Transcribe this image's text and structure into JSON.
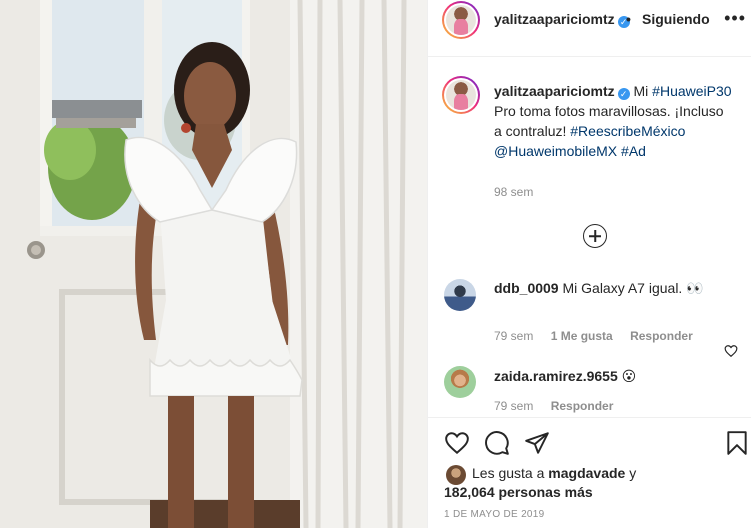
{
  "post": {
    "username": "yalitzaapariciomtz",
    "verified_icon": "verified-badge-icon",
    "follow_status": "Siguiendo",
    "separator": "•",
    "more_icon": "more-options-icon",
    "photo_description_icon": "photo"
  },
  "caption": {
    "username": "yalitzaapariciomtz",
    "text_1": "Mi",
    "hashtag_1": "#HuaweiP30",
    "text_2": "Pro toma fotos maravillosas. ¡Incluso a contraluz!",
    "hashtag_2": "#ReescribeMéxico",
    "mention": "@HuaweimobileMX",
    "hashtag_3": "#Ad",
    "time": "98 sem"
  },
  "load_more_icon": "plus-circle-icon",
  "comments": [
    {
      "username": "ddb_0009",
      "text": "Mi Galaxy A7 igual. 👀",
      "time": "79 sem",
      "likes": "1 Me gusta",
      "reply": "Responder"
    },
    {
      "username": "zaida.ramirez.9655",
      "text": "😮",
      "time": "79 sem",
      "reply": "Responder"
    }
  ],
  "actions": {
    "like_icon": "heart-icon",
    "comment_icon": "comment-icon",
    "share_icon": "paper-plane-icon",
    "save_icon": "bookmark-icon"
  },
  "likes": {
    "prefix": "Les gusta a",
    "user": "magdavade",
    "suffix": "y",
    "count": "182,064 personas más"
  },
  "date": "1 DE MAYO DE 2019",
  "colors": {
    "link": "#00376b",
    "secondary_text": "#8e8e8e",
    "verified": "#3897f0",
    "border": "#efefef"
  }
}
